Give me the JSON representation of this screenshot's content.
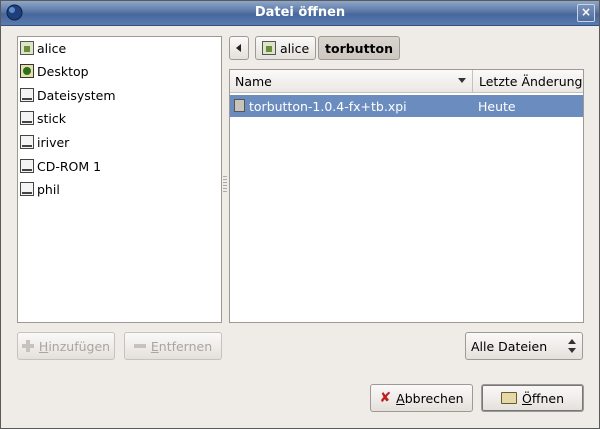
{
  "window": {
    "title": "Datei öffnen",
    "close": "×"
  },
  "places": [
    {
      "label": "alice",
      "icon": "home-folder-icon"
    },
    {
      "label": "Desktop",
      "icon": "desktop-icon"
    },
    {
      "label": "Dateisystem",
      "icon": "drive-icon"
    },
    {
      "label": "stick",
      "icon": "drive-icon"
    },
    {
      "label": "iriver",
      "icon": "drive-icon"
    },
    {
      "label": "CD-ROM 1",
      "icon": "drive-icon"
    },
    {
      "label": "phil",
      "icon": "drive-icon"
    }
  ],
  "path": {
    "crumbs": [
      "alice",
      "torbutton"
    ],
    "active": "torbutton"
  },
  "files": {
    "columns": {
      "name": "Name",
      "modified": "Letzte Änderung"
    },
    "rows": [
      {
        "name": "torbutton-1.0.4-fx+tb.xpi",
        "modified": "Heute",
        "selected": true
      }
    ]
  },
  "buttons": {
    "add": {
      "u": "H",
      "rest": "inzufügen"
    },
    "remove": {
      "u": "E",
      "rest": "ntfernen"
    },
    "cancel": {
      "u": "A",
      "rest": "bbrechen"
    },
    "open": {
      "u": "Ö",
      "rest": "ffnen"
    }
  },
  "filter": {
    "selected": "Alle Dateien"
  },
  "colors": {
    "selection": "#6b8cbe",
    "window_bg": "#efebe7",
    "titlebar": "#5876a6"
  }
}
